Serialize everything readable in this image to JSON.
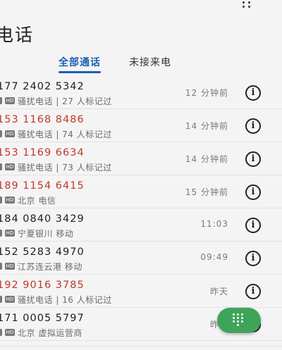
{
  "header": {
    "title": "电话",
    "menu_icon": "more-vert-icon"
  },
  "tabs": [
    {
      "label": "全部通话",
      "active": true
    },
    {
      "label": "未接来电",
      "active": false
    }
  ],
  "calls": [
    {
      "number": "177 2402 5342",
      "sim": "2",
      "hd": "HD",
      "detail": "骚扰电话 | 27 人标记过",
      "time": "12 分钟前",
      "highlight": false
    },
    {
      "number": "153 1168 8486",
      "sim": "2",
      "hd": "HD",
      "detail": "骚扰电话 | 74 人标记过",
      "time": "14 分钟前",
      "highlight": true
    },
    {
      "number": "153 1169 6634",
      "sim": "2",
      "hd": "HD",
      "detail": "骚扰电话 | 73 人标记过",
      "time": "14 分钟前",
      "highlight": true
    },
    {
      "number": "189 1154 6415",
      "sim": "2",
      "hd": "HD",
      "detail": "北京 电信",
      "time": "15 分钟前",
      "highlight": true
    },
    {
      "number": "184 0840 3429",
      "sim": "2",
      "hd": "HD",
      "detail": "宁夏银川 移动",
      "time": "11:03",
      "highlight": false
    },
    {
      "number": "152 5283 4970",
      "sim": "2",
      "hd": "HD",
      "detail": "江苏连云港 移动",
      "time": "09:49",
      "highlight": false
    },
    {
      "number": "192 9016 3785",
      "sim": "2",
      "hd": "HD",
      "detail": "骚扰电话 | 16 人标记过",
      "time": "昨天",
      "highlight": true
    },
    {
      "number": "171 0005 5797",
      "sim": "2",
      "hd": "HD",
      "detail": "北京 虚拟运营商",
      "time": "昨天",
      "highlight": false
    }
  ],
  "info_icon": "info-circle-icon",
  "fab_icon": "dialpad-icon",
  "colors": {
    "accent": "#1a5fb4",
    "spam": "#c0392b",
    "fab": "#3fa45a"
  }
}
